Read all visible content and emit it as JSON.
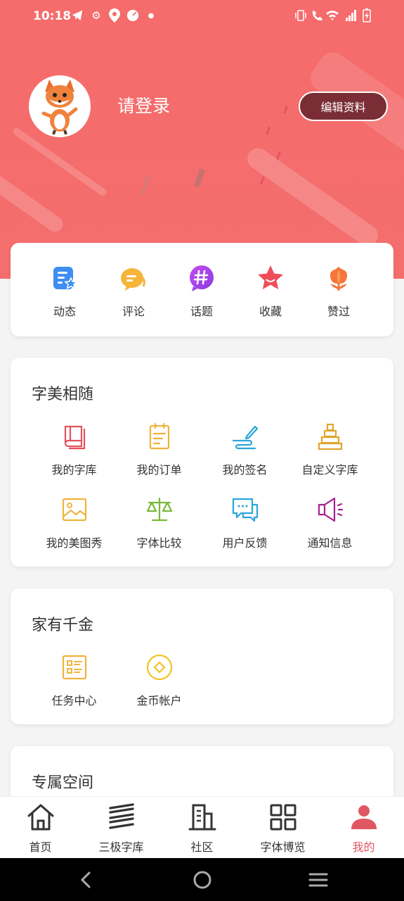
{
  "status_bar": {
    "time": "10:18"
  },
  "header": {
    "login_text": "请登录",
    "edit_button": "编辑资料"
  },
  "quick_actions": [
    {
      "label": "动态",
      "icon": "feed-icon"
    },
    {
      "label": "评论",
      "icon": "comment-icon"
    },
    {
      "label": "话题",
      "icon": "topic-icon"
    },
    {
      "label": "收藏",
      "icon": "star-icon"
    },
    {
      "label": "赞过",
      "icon": "tulip-icon"
    }
  ],
  "section1": {
    "title": "字美相随",
    "items": [
      {
        "label": "我的字库"
      },
      {
        "label": "我的订单"
      },
      {
        "label": "我的签名"
      },
      {
        "label": "自定义字库"
      },
      {
        "label": "我的美图秀"
      },
      {
        "label": "字体比较"
      },
      {
        "label": "用户反馈"
      },
      {
        "label": "通知信息"
      }
    ]
  },
  "section2": {
    "title": "家有千金",
    "items": [
      {
        "label": "任务中心"
      },
      {
        "label": "金币帐户"
      }
    ]
  },
  "section3": {
    "title": "专属空间"
  },
  "bottom_nav": [
    {
      "label": "首页"
    },
    {
      "label": "三极字库"
    },
    {
      "label": "社区"
    },
    {
      "label": "字体博览"
    },
    {
      "label": "我的"
    }
  ],
  "colors": {
    "header_bg": "#f66b6b",
    "accent": "#e05763",
    "edit_button_bg": "#7a2d34"
  }
}
